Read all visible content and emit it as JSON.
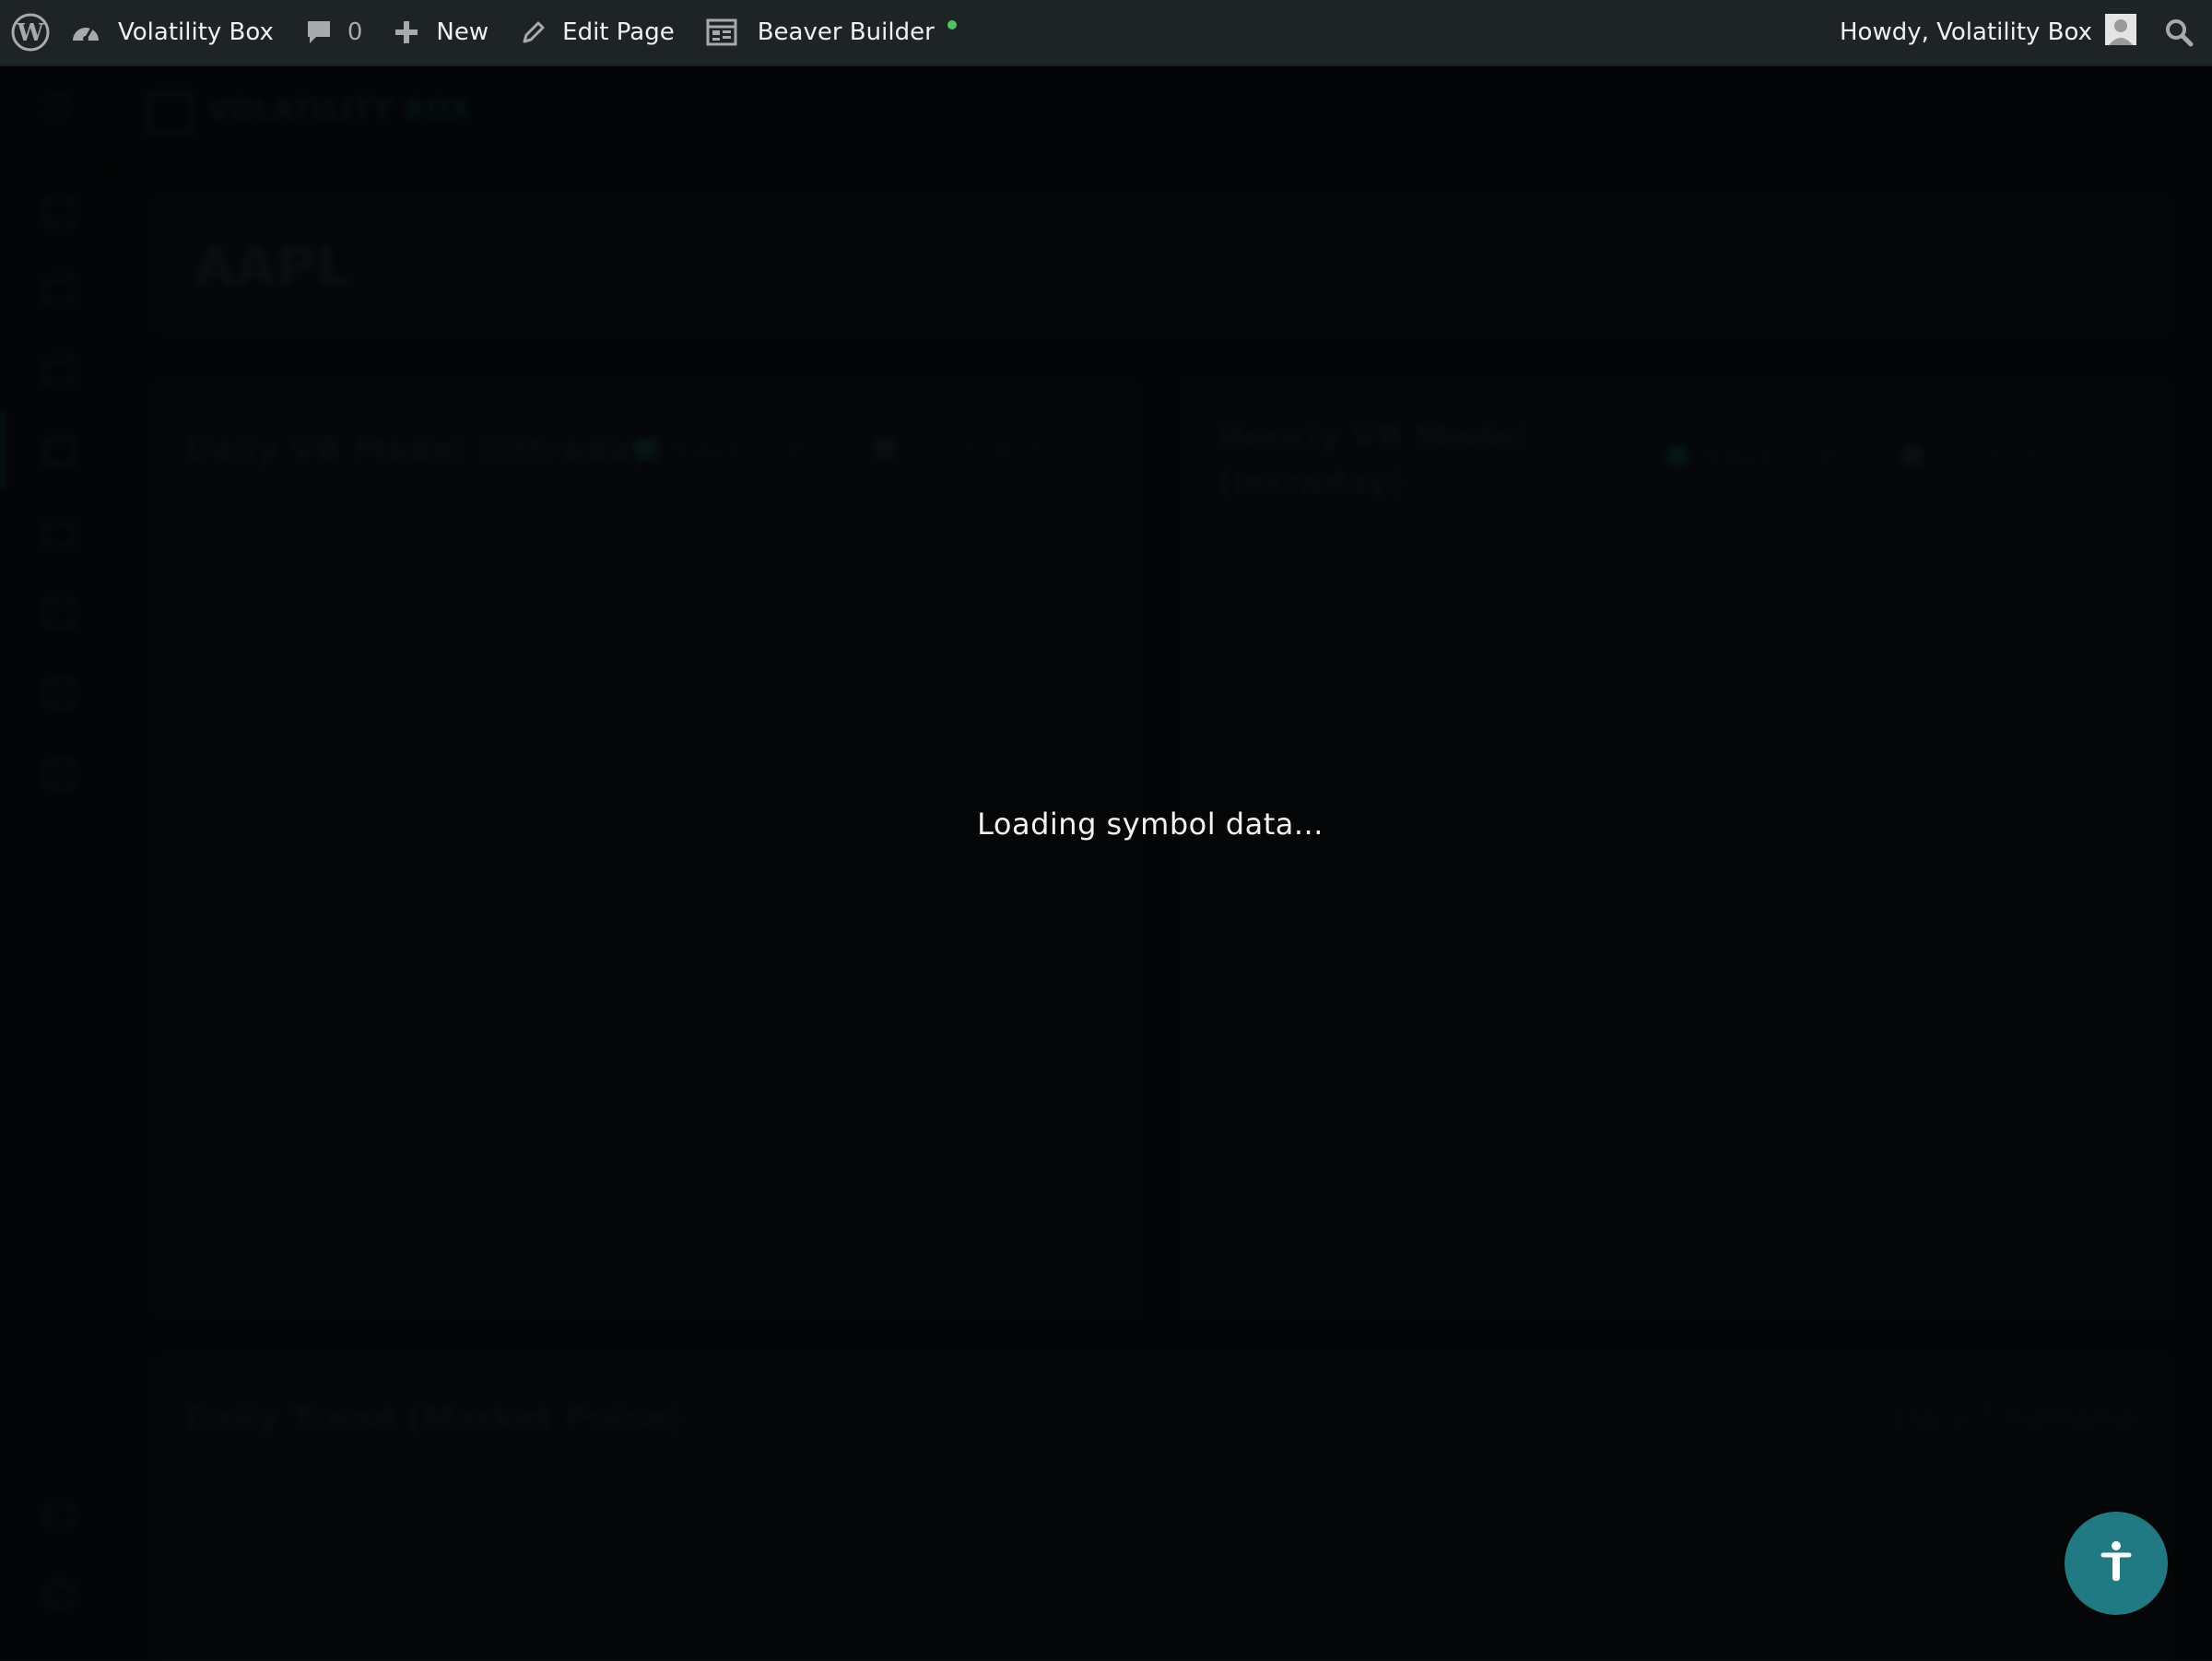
{
  "adminbar": {
    "site_name": "Volatility Box",
    "comments_count": "0",
    "new_label": "New",
    "edit_label": "Edit Page",
    "builder_label": "Beaver Builder",
    "greeting": "Howdy, Volatility Box",
    "icons": [
      "wordpress-logo-icon",
      "dashboard-icon",
      "comment-icon",
      "plus-icon",
      "pencil-icon",
      "builder-icon",
      "search-icon",
      "user-avatar-icon"
    ]
  },
  "background": {
    "brand_primary": "VOLATILITY",
    "brand_accent": "BOX",
    "symbol": "AAPL",
    "symbol_dash": "—",
    "panel_left_title": "Daily VB Model (Intraday)",
    "panel_left_toggle_a": "Aggressive",
    "panel_left_toggle_b": "Conservative",
    "panel_right_title_line1": "Hourly VB Model",
    "panel_right_title_line2": "(Intraday)",
    "panel_right_toggle_a": "Aggressive",
    "panel_right_toggle_b": "Conservative",
    "bottom_panel_title": "Daily Trend (Market Pulse)",
    "bottom_panel_right": "Daily Timeframe",
    "stats": [
      {
        "label": "Last Price",
        "value": "—"
      },
      {
        "label": "Implied Volatility",
        "value": "—"
      },
      {
        "label": "Beta",
        "value": "—"
      },
      {
        "label": "Earnings Date",
        "value": "—"
      }
    ]
  },
  "overlay": {
    "loading_text": "Loading symbol data..."
  },
  "accessibility_button": {
    "icon": "accessibility-person-icon"
  },
  "colors": {
    "adminbar_bg": "#1e2326",
    "page_bg": "#06080a",
    "live_dot": "#4fc563",
    "fab": "#1f7a83"
  }
}
